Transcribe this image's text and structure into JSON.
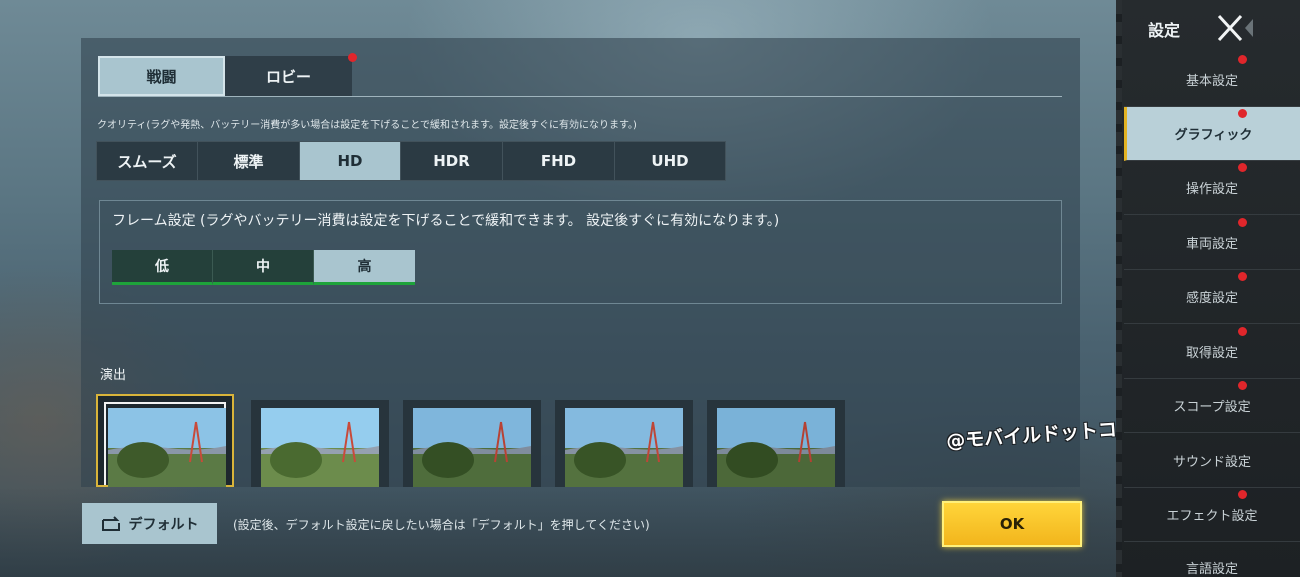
{
  "tabs": [
    {
      "label": "戦闘",
      "active": true
    },
    {
      "label": "ロビー",
      "active": false,
      "badge": true
    }
  ],
  "quality": {
    "description": "クオリティ(ラグや発熱、バッテリー消費が多い場合は設定を下げることで緩和されます。設定後すぐに有効になります。)",
    "options": [
      "スムーズ",
      "標準",
      "HD",
      "HDR",
      "FHD",
      "UHD"
    ],
    "selected": "HD"
  },
  "frame": {
    "label": "フレーム設定 (ラグやバッテリー消費は設定を下げることで緩和できます。 設定後すぐに有効になります。)",
    "options": [
      "低",
      "中",
      "高"
    ],
    "selected": "高"
  },
  "effects": {
    "label": "演出",
    "thumbnail_count": 5,
    "selected_index": 0
  },
  "footer": {
    "default_label": "デフォルト",
    "default_note": "(設定後、デフォルト設定に戻したい場合は「デフォルト」を押してください)",
    "ok_label": "OK"
  },
  "watermark": "@モバイルドットコム",
  "sidebar": {
    "title": "設定",
    "items": [
      {
        "label": "基本設定",
        "badge": true,
        "active": false
      },
      {
        "label": "グラフィック",
        "badge": true,
        "active": true
      },
      {
        "label": "操作設定",
        "badge": true,
        "active": false
      },
      {
        "label": "車両設定",
        "badge": true,
        "active": false
      },
      {
        "label": "感度設定",
        "badge": true,
        "active": false
      },
      {
        "label": "取得設定",
        "badge": true,
        "active": false
      },
      {
        "label": "スコープ設定",
        "badge": true,
        "active": false
      },
      {
        "label": "サウンド設定",
        "badge": false,
        "active": false
      },
      {
        "label": "エフェクト設定",
        "badge": true,
        "active": false
      },
      {
        "label": "言語設定",
        "badge": false,
        "active": false
      }
    ]
  },
  "colors": {
    "accent_selected": "#a9c5cf",
    "badge_red": "#e0262b",
    "ok_yellow": "#f2b51c",
    "frame_green": "#1ea33a",
    "thumb_selected_gold": "#d9b43a"
  }
}
